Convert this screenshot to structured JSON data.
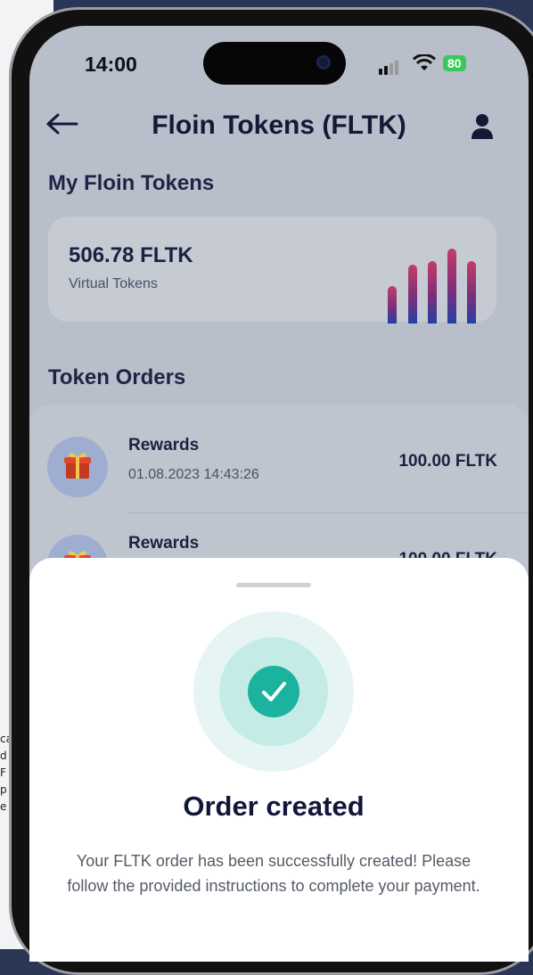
{
  "status_bar": {
    "time": "14:00",
    "battery": "80"
  },
  "header": {
    "title": "Floin Tokens (FLTK)"
  },
  "tokens": {
    "section_title": "My Floin Tokens",
    "balance": "506.78 FLTK",
    "balance_label": "Virtual Tokens",
    "chart_levels": [
      0.48,
      0.75,
      0.79,
      0.96,
      0.79
    ]
  },
  "orders": {
    "section_title": "Token Orders",
    "items": [
      {
        "name": "Rewards",
        "date": "01.08.2023 14:43:26",
        "amount": "100.00 FLTK"
      },
      {
        "name": "Rewards",
        "date": "",
        "amount": "100.00 FLTK"
      }
    ]
  },
  "sheet": {
    "title": "Order created",
    "message": "Your FLTK order has been successfully created! Please follow the provided instructions to complete your payment."
  },
  "background_text": [
    "ca",
    "d",
    "F",
    "p",
    "e"
  ],
  "colors": {
    "accent": "#1bb39e",
    "title": "#12173a",
    "battery": "#37c95a"
  }
}
